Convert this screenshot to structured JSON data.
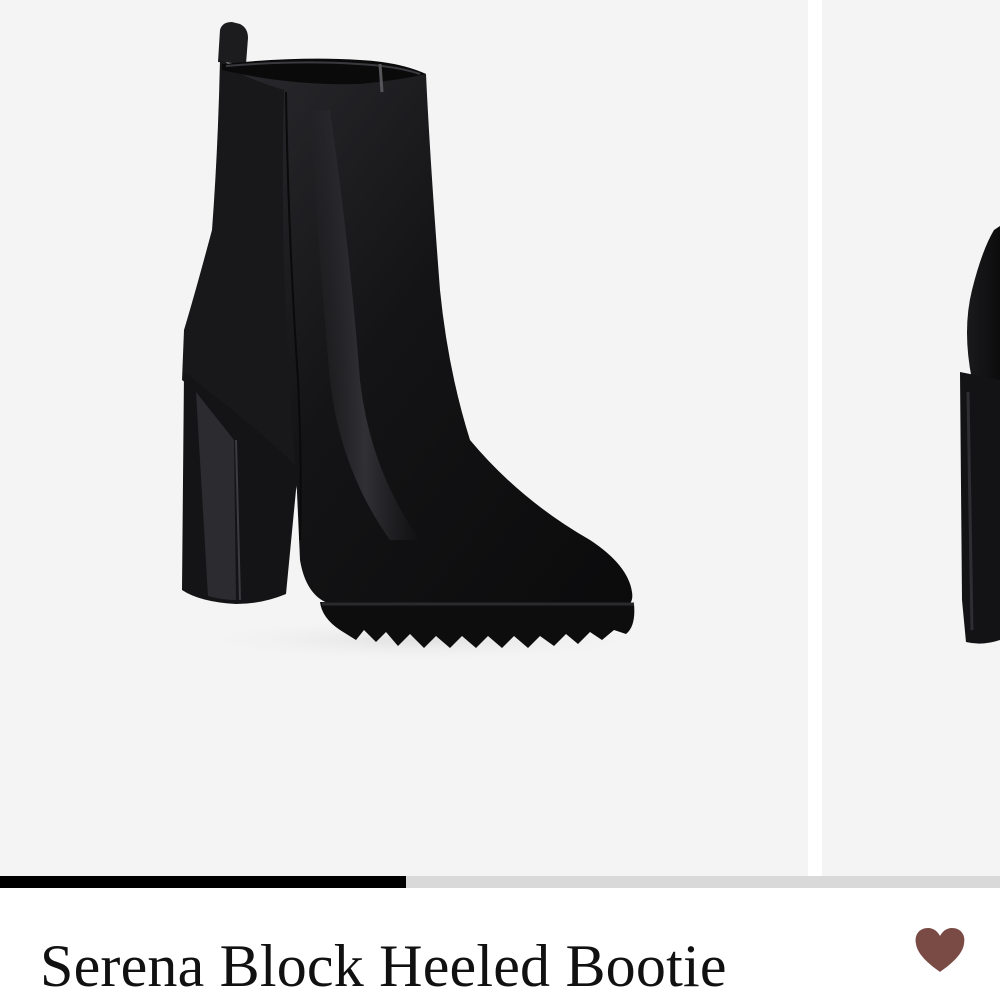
{
  "product": {
    "title": "Serena Block Heeled Bootie"
  },
  "carousel": {
    "slide_count_visible": 2,
    "progress": 0.406
  },
  "icons": {
    "favorite": "heart-icon"
  },
  "colors": {
    "heart": "#7a4a45",
    "progress_fill": "#000000",
    "progress_track": "#d9d9d9",
    "image_background": "#f4f4f4"
  }
}
